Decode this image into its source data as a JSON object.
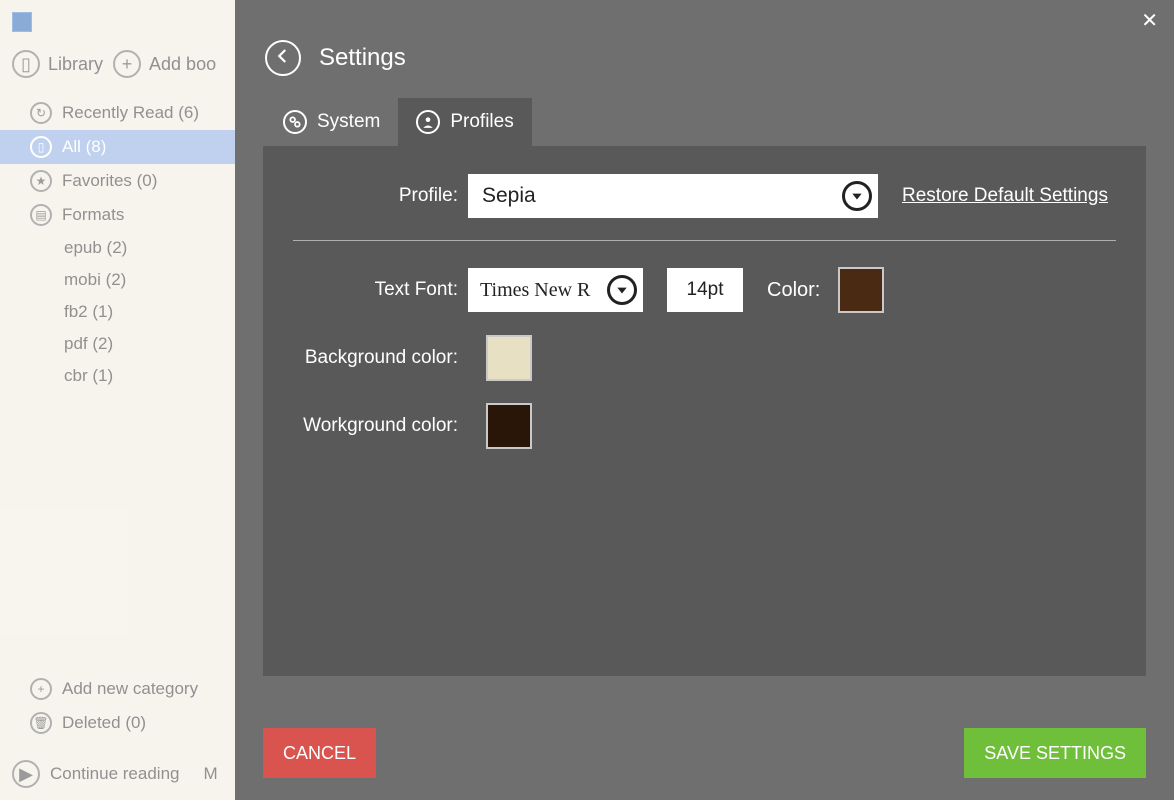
{
  "sidebar": {
    "library_label": "Library",
    "add_book_label": "Add boo",
    "items": [
      {
        "icon": "recent",
        "label": "Recently Read (6)"
      },
      {
        "icon": "book",
        "label": "All (8)",
        "selected": true
      },
      {
        "icon": "star",
        "label": "Favorites (0)"
      },
      {
        "icon": "doc",
        "label": "Formats"
      }
    ],
    "format_items": [
      {
        "label": "epub (2)"
      },
      {
        "label": "mobi (2)"
      },
      {
        "label": "fb2 (1)"
      },
      {
        "label": "pdf (2)"
      },
      {
        "label": "cbr (1)"
      }
    ],
    "bottom": {
      "add_category_label": "Add new category",
      "deleted_label": "Deleted (0)"
    },
    "continue_label": "Continue reading",
    "continue_trail": "M"
  },
  "settings": {
    "title": "Settings",
    "close_char": "✕",
    "tabs": [
      {
        "id": "system",
        "label": "System",
        "active": false
      },
      {
        "id": "profiles",
        "label": "Profiles",
        "active": true
      }
    ],
    "profile_label": "Profile:",
    "profile_value": "Sepia",
    "restore_label": "Restore Default Settings",
    "font_label": "Text Font:",
    "font_value": "Times New R",
    "font_size_value": "14pt",
    "color_label": "Color:",
    "text_color": "#4a2a12",
    "bg_label": "Background color:",
    "bg_color": "#e8e0c3",
    "wk_label": "Workground color:",
    "wk_color": "#2a1608",
    "cancel_label": "CANCEL",
    "save_label": "SAVE SETTINGS"
  }
}
